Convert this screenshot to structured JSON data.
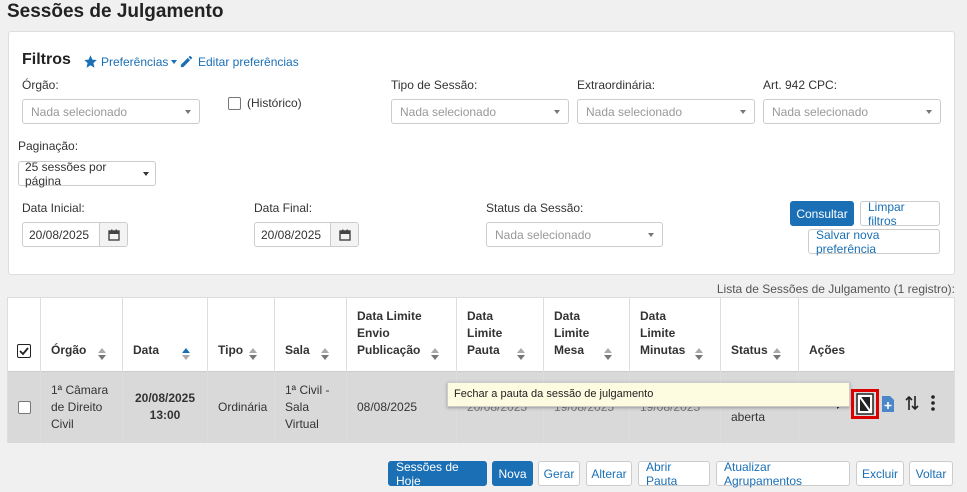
{
  "page": {
    "title": "Sessões de Julgamento"
  },
  "filters": {
    "title": "Filtros",
    "preferences_label": "Preferências",
    "edit_preferences_label": "Editar preferências",
    "orgao": {
      "label": "Órgão:",
      "placeholder": "Nada selecionado"
    },
    "historico_label": "(Histórico)",
    "tipo_sessao": {
      "label": "Tipo de Sessão:",
      "placeholder": "Nada selecionado"
    },
    "extraordinaria": {
      "label": "Extraordinária:",
      "placeholder": "Nada selecionado"
    },
    "art942": {
      "label": "Art. 942 CPC:",
      "placeholder": "Nada selecionado"
    },
    "paginacao": {
      "label": "Paginação:",
      "value": "25 sessões por página"
    },
    "data_inicial": {
      "label": "Data Inicial:",
      "value": "20/08/2025"
    },
    "data_final": {
      "label": "Data Final:",
      "value": "20/08/2025"
    },
    "status_sessao": {
      "label": "Status da Sessão:",
      "placeholder": "Nada selecionado"
    },
    "consultar_label": "Consultar",
    "limpar_label": "Limpar filtros",
    "salvar_pref_label": "Salvar nova preferência"
  },
  "list_caption": "Lista de Sessões de Julgamento (1 registro):",
  "table": {
    "headers": {
      "orgao": "Órgão",
      "data": "Data",
      "tipo": "Tipo",
      "sala": "Sala",
      "data_limite_envio": "Data Limite\nEnvio\nPublicação",
      "data_limite_pauta": "Data\nLimite\nPauta",
      "data_limite_mesa": "Data\nLimite\nMesa",
      "data_limite_minutas": "Data\nLimite\nMinutas",
      "status": "Status",
      "acoes": "Ações"
    },
    "row": {
      "orgao": "1ª Câmara\nde Direito\nCivil",
      "data": "20/08/2025\n13:00",
      "tipo": "Ordinária",
      "sala": "1ª Civil -\nSala\nVirtual",
      "data_limite_envio": "08/08/2025",
      "data_limite_pauta": "20/08/2025",
      "data_limite_mesa": "19/08/2025",
      "data_limite_minutas": "19/08/2025",
      "status": "aberta"
    }
  },
  "tooltip": "Fechar a pauta da sessão de julgamento",
  "bottom_buttons": {
    "sessoes_hoje": "Sessões de Hoje",
    "nova": "Nova",
    "gerar": "Gerar",
    "alterar": "Alterar",
    "abrir_pauta": "Abrir Pauta",
    "atualizar_agrupamentos": "Atualizar Agrupamentos",
    "excluir": "Excluir",
    "voltar": "Voltar"
  },
  "colors": {
    "primary": "#1a6fb5",
    "highlight": "#d00000",
    "row_bg": "#d9d9d9"
  }
}
